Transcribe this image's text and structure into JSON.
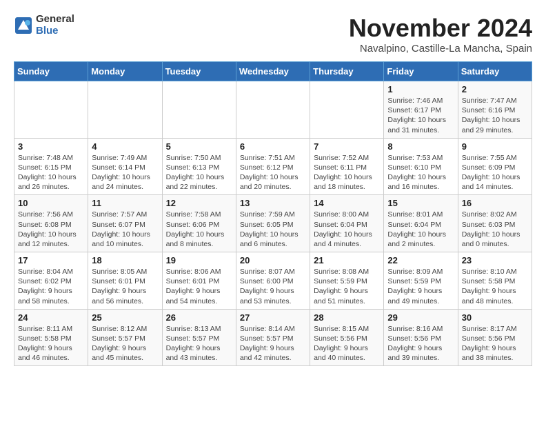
{
  "logo": {
    "general": "General",
    "blue": "Blue"
  },
  "title": "November 2024",
  "location": "Navalpino, Castille-La Mancha, Spain",
  "headers": [
    "Sunday",
    "Monday",
    "Tuesday",
    "Wednesday",
    "Thursday",
    "Friday",
    "Saturday"
  ],
  "weeks": [
    [
      {
        "day": "",
        "info": ""
      },
      {
        "day": "",
        "info": ""
      },
      {
        "day": "",
        "info": ""
      },
      {
        "day": "",
        "info": ""
      },
      {
        "day": "",
        "info": ""
      },
      {
        "day": "1",
        "info": "Sunrise: 7:46 AM\nSunset: 6:17 PM\nDaylight: 10 hours and 31 minutes."
      },
      {
        "day": "2",
        "info": "Sunrise: 7:47 AM\nSunset: 6:16 PM\nDaylight: 10 hours and 29 minutes."
      }
    ],
    [
      {
        "day": "3",
        "info": "Sunrise: 7:48 AM\nSunset: 6:15 PM\nDaylight: 10 hours and 26 minutes."
      },
      {
        "day": "4",
        "info": "Sunrise: 7:49 AM\nSunset: 6:14 PM\nDaylight: 10 hours and 24 minutes."
      },
      {
        "day": "5",
        "info": "Sunrise: 7:50 AM\nSunset: 6:13 PM\nDaylight: 10 hours and 22 minutes."
      },
      {
        "day": "6",
        "info": "Sunrise: 7:51 AM\nSunset: 6:12 PM\nDaylight: 10 hours and 20 minutes."
      },
      {
        "day": "7",
        "info": "Sunrise: 7:52 AM\nSunset: 6:11 PM\nDaylight: 10 hours and 18 minutes."
      },
      {
        "day": "8",
        "info": "Sunrise: 7:53 AM\nSunset: 6:10 PM\nDaylight: 10 hours and 16 minutes."
      },
      {
        "day": "9",
        "info": "Sunrise: 7:55 AM\nSunset: 6:09 PM\nDaylight: 10 hours and 14 minutes."
      }
    ],
    [
      {
        "day": "10",
        "info": "Sunrise: 7:56 AM\nSunset: 6:08 PM\nDaylight: 10 hours and 12 minutes."
      },
      {
        "day": "11",
        "info": "Sunrise: 7:57 AM\nSunset: 6:07 PM\nDaylight: 10 hours and 10 minutes."
      },
      {
        "day": "12",
        "info": "Sunrise: 7:58 AM\nSunset: 6:06 PM\nDaylight: 10 hours and 8 minutes."
      },
      {
        "day": "13",
        "info": "Sunrise: 7:59 AM\nSunset: 6:05 PM\nDaylight: 10 hours and 6 minutes."
      },
      {
        "day": "14",
        "info": "Sunrise: 8:00 AM\nSunset: 6:04 PM\nDaylight: 10 hours and 4 minutes."
      },
      {
        "day": "15",
        "info": "Sunrise: 8:01 AM\nSunset: 6:04 PM\nDaylight: 10 hours and 2 minutes."
      },
      {
        "day": "16",
        "info": "Sunrise: 8:02 AM\nSunset: 6:03 PM\nDaylight: 10 hours and 0 minutes."
      }
    ],
    [
      {
        "day": "17",
        "info": "Sunrise: 8:04 AM\nSunset: 6:02 PM\nDaylight: 9 hours and 58 minutes."
      },
      {
        "day": "18",
        "info": "Sunrise: 8:05 AM\nSunset: 6:01 PM\nDaylight: 9 hours and 56 minutes."
      },
      {
        "day": "19",
        "info": "Sunrise: 8:06 AM\nSunset: 6:01 PM\nDaylight: 9 hours and 54 minutes."
      },
      {
        "day": "20",
        "info": "Sunrise: 8:07 AM\nSunset: 6:00 PM\nDaylight: 9 hours and 53 minutes."
      },
      {
        "day": "21",
        "info": "Sunrise: 8:08 AM\nSunset: 5:59 PM\nDaylight: 9 hours and 51 minutes."
      },
      {
        "day": "22",
        "info": "Sunrise: 8:09 AM\nSunset: 5:59 PM\nDaylight: 9 hours and 49 minutes."
      },
      {
        "day": "23",
        "info": "Sunrise: 8:10 AM\nSunset: 5:58 PM\nDaylight: 9 hours and 48 minutes."
      }
    ],
    [
      {
        "day": "24",
        "info": "Sunrise: 8:11 AM\nSunset: 5:58 PM\nDaylight: 9 hours and 46 minutes."
      },
      {
        "day": "25",
        "info": "Sunrise: 8:12 AM\nSunset: 5:57 PM\nDaylight: 9 hours and 45 minutes."
      },
      {
        "day": "26",
        "info": "Sunrise: 8:13 AM\nSunset: 5:57 PM\nDaylight: 9 hours and 43 minutes."
      },
      {
        "day": "27",
        "info": "Sunrise: 8:14 AM\nSunset: 5:57 PM\nDaylight: 9 hours and 42 minutes."
      },
      {
        "day": "28",
        "info": "Sunrise: 8:15 AM\nSunset: 5:56 PM\nDaylight: 9 hours and 40 minutes."
      },
      {
        "day": "29",
        "info": "Sunrise: 8:16 AM\nSunset: 5:56 PM\nDaylight: 9 hours and 39 minutes."
      },
      {
        "day": "30",
        "info": "Sunrise: 8:17 AM\nSunset: 5:56 PM\nDaylight: 9 hours and 38 minutes."
      }
    ]
  ]
}
